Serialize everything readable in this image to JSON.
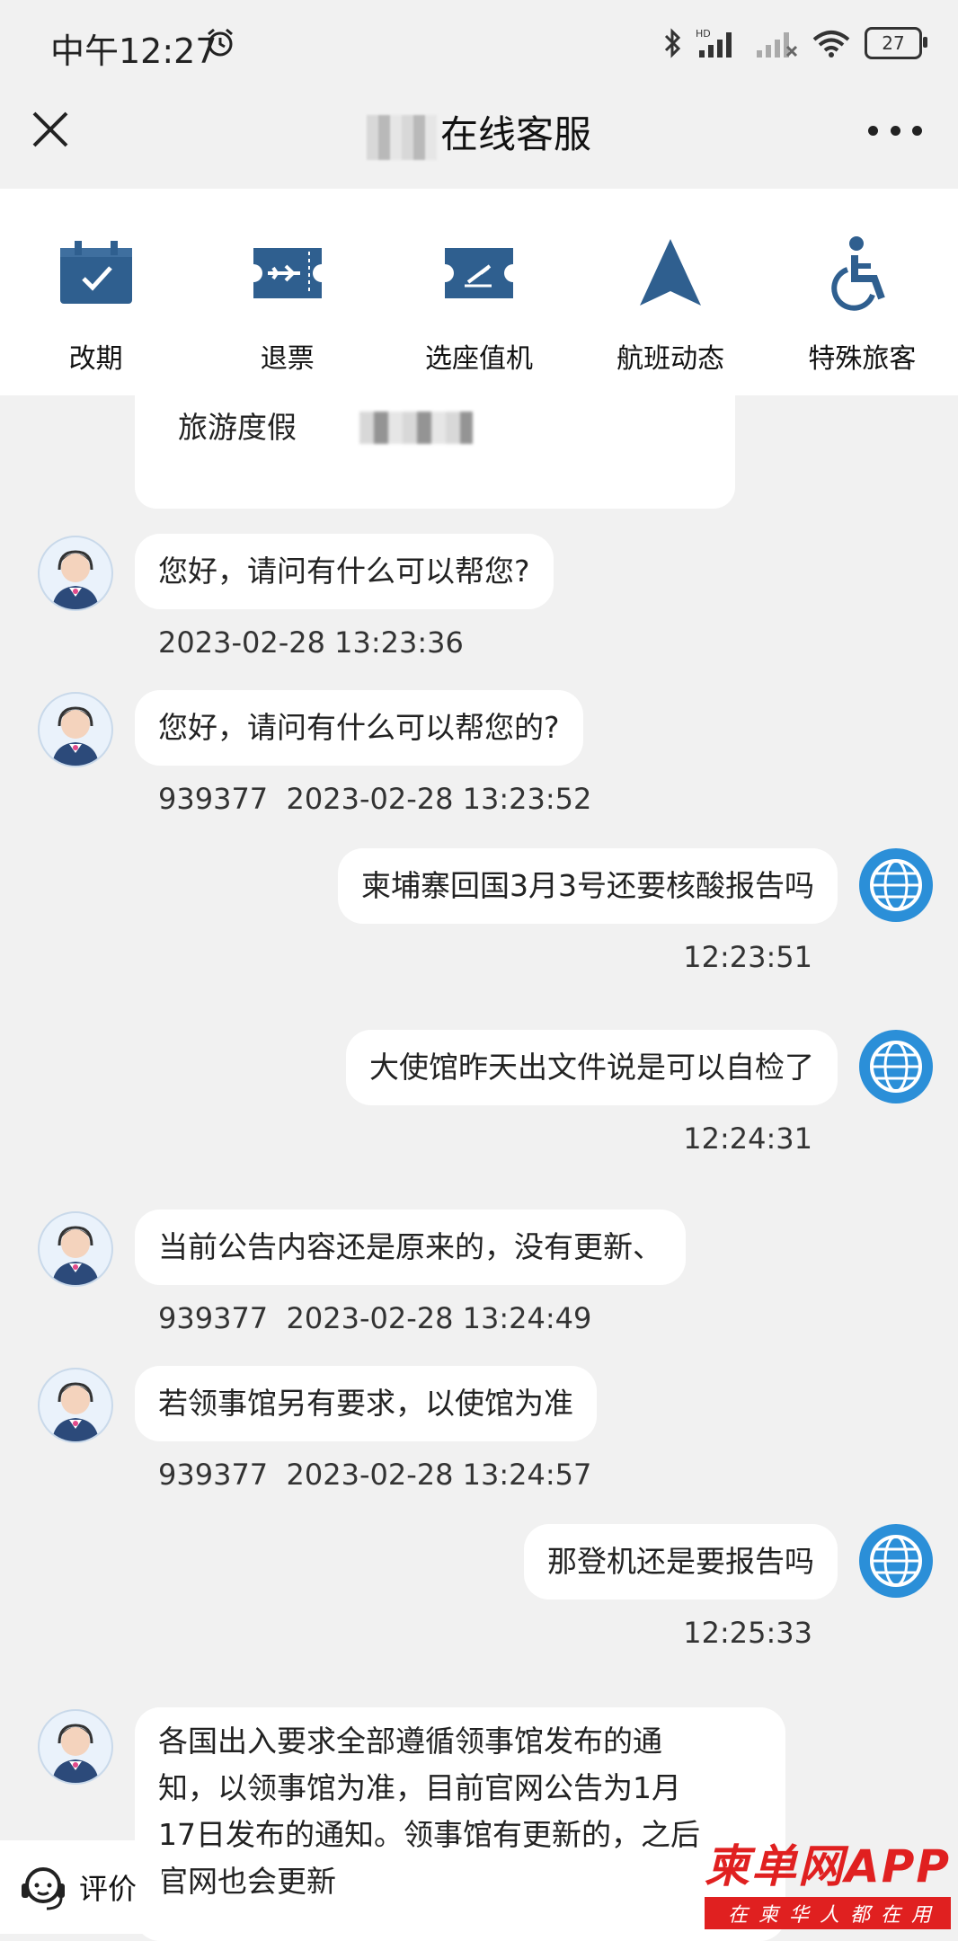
{
  "status": {
    "time": "中午12:27",
    "battery": "27"
  },
  "nav": {
    "title": "在线客服"
  },
  "quick_actions": [
    {
      "label": "改期",
      "icon": "calendar-check-icon"
    },
    {
      "label": "退票",
      "icon": "plane-ticket-icon"
    },
    {
      "label": "选座值机",
      "icon": "boarding-pass-icon"
    },
    {
      "label": "航班动态",
      "icon": "navigation-arrow-icon"
    },
    {
      "label": "特殊旅客",
      "icon": "wheelchair-icon"
    }
  ],
  "messages": [
    {
      "side": "agent",
      "text": "旅游度假"
    },
    {
      "side": "agent",
      "text": "您好，请问有什么可以帮您?",
      "meta": "2023-02-28 13:23:36"
    },
    {
      "side": "agent",
      "text": "您好，请问有什么可以帮您的?",
      "meta": "939377  2023-02-28 13:23:52"
    },
    {
      "side": "user",
      "text": "柬埔寨回国3月3号还要核酸报告吗",
      "meta": "12:23:51"
    },
    {
      "side": "user",
      "text": "大使馆昨天出文件说是可以自检了",
      "meta": "12:24:31"
    },
    {
      "side": "agent",
      "text": "当前公告内容还是原来的，没有更新、",
      "meta": "939377  2023-02-28 13:24:49"
    },
    {
      "side": "agent",
      "text": "若领事馆另有要求，以使馆为准",
      "meta": "939377  2023-02-28 13:24:57"
    },
    {
      "side": "user",
      "text": "那登机还是要报告吗",
      "meta": "12:25:33"
    },
    {
      "side": "agent",
      "lines": [
        "各国出入要求全部遵循领事馆发布的通",
        "知，以领事馆为准，目前官网公告为1月",
        "17日发布的通知。领事馆有更新的，之后",
        "官网也会更新"
      ]
    }
  ],
  "footer": {
    "evaluate_label": "评价"
  },
  "watermark": {
    "main": "柬单网APP",
    "sub": "在柬华人都在用"
  },
  "colors": {
    "icon_blue": "#2f5f8f",
    "user_avatar": "#2b8fd8",
    "watermark_red": "#e02020"
  }
}
